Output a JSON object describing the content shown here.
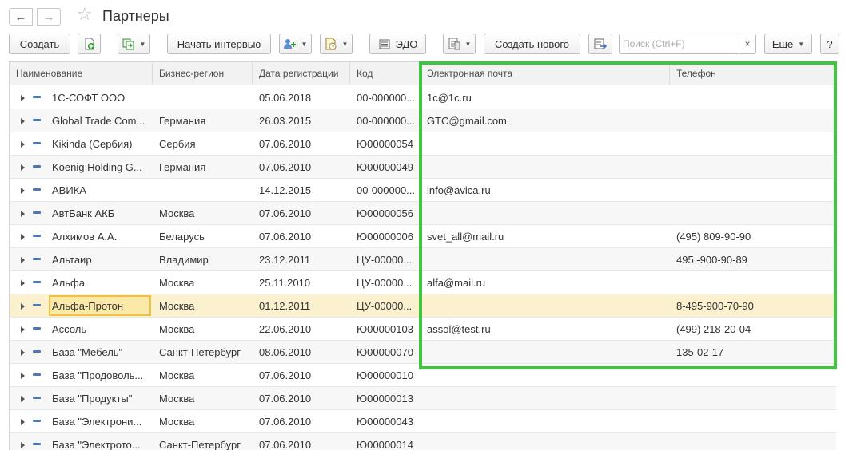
{
  "window": {
    "title": "Партнеры"
  },
  "nav": {
    "back": "←",
    "forward": "→",
    "favorite": "☆"
  },
  "toolbar": {
    "create": "Создать",
    "start_interaction": "Начать интервью",
    "edo": "ЭДО",
    "create_new": "Создать нового",
    "search_placeholder": "Поиск (Ctrl+F)",
    "search_clear": "×",
    "more": "Еще",
    "help": "?"
  },
  "table": {
    "columns": [
      "Наименование",
      "Бизнес-регион",
      "Дата регистрации",
      "Код",
      "Электронная почта",
      "Телефон"
    ],
    "rows": [
      {
        "name": "1С-СОФТ ООО",
        "region": "",
        "date": "05.06.2018",
        "code": "00-000000...",
        "email": "1c@1c.ru",
        "phone": ""
      },
      {
        "name": "Global Trade Com...",
        "region": "Германия",
        "date": "26.03.2015",
        "code": "00-000000...",
        "email": "GTC@gmail.com",
        "phone": ""
      },
      {
        "name": "Kikinda (Сербия)",
        "region": "Сербия",
        "date": "07.06.2010",
        "code": "Ю00000054",
        "email": "",
        "phone": ""
      },
      {
        "name": "Koenig Holding G...",
        "region": "Германия",
        "date": "07.06.2010",
        "code": "Ю00000049",
        "email": "",
        "phone": ""
      },
      {
        "name": "АВИКА",
        "region": "",
        "date": "14.12.2015",
        "code": "00-000000...",
        "email": "info@avica.ru",
        "phone": ""
      },
      {
        "name": "АвтБанк АКБ",
        "region": "Москва",
        "date": "07.06.2010",
        "code": "Ю00000056",
        "email": "",
        "phone": ""
      },
      {
        "name": "Алхимов А.А.",
        "region": "Беларусь",
        "date": "07.06.2010",
        "code": "Ю00000006",
        "email": "svet_all@mail.ru",
        "phone": "(495) 809-90-90"
      },
      {
        "name": "Альтаир",
        "region": "Владимир",
        "date": "23.12.2011",
        "code": "ЦУ-00000...",
        "email": "",
        "phone": "495 -900-90-89"
      },
      {
        "name": "Альфа",
        "region": "Москва",
        "date": "25.11.2010",
        "code": "ЦУ-00000...",
        "email": "alfa@mail.ru",
        "phone": ""
      },
      {
        "name": "Альфа-Протон",
        "region": "Москва",
        "date": "01.12.2011",
        "code": "ЦУ-00000...",
        "email": "",
        "phone": "8-495-900-70-90"
      },
      {
        "name": "Ассоль",
        "region": "Москва",
        "date": "22.06.2010",
        "code": "Ю00000103",
        "email": "assol@test.ru",
        "phone": "(499) 218-20-04"
      },
      {
        "name": "База \"Мебель\"",
        "region": "Санкт-Петербург",
        "date": "08.06.2010",
        "code": "Ю00000070",
        "email": "",
        "phone": "135-02-17"
      },
      {
        "name": "База \"Продоволь...",
        "region": "Москва",
        "date": "07.06.2010",
        "code": "Ю00000010",
        "email": "",
        "phone": ""
      },
      {
        "name": "База \"Продукты\"",
        "region": "Москва",
        "date": "07.06.2010",
        "code": "Ю00000013",
        "email": "",
        "phone": ""
      },
      {
        "name": "База \"Электрони...",
        "region": "Москва",
        "date": "07.06.2010",
        "code": "Ю00000043",
        "email": "",
        "phone": ""
      },
      {
        "name": "База \"Электрото...",
        "region": "Санкт-Петербург",
        "date": "07.06.2010",
        "code": "Ю00000014",
        "email": "",
        "phone": ""
      }
    ],
    "selected_row": 9
  },
  "colors": {
    "highlight": "#3ec63e",
    "selected_row": "#fbf1cf",
    "selected_cell": "#fbe9a8"
  }
}
